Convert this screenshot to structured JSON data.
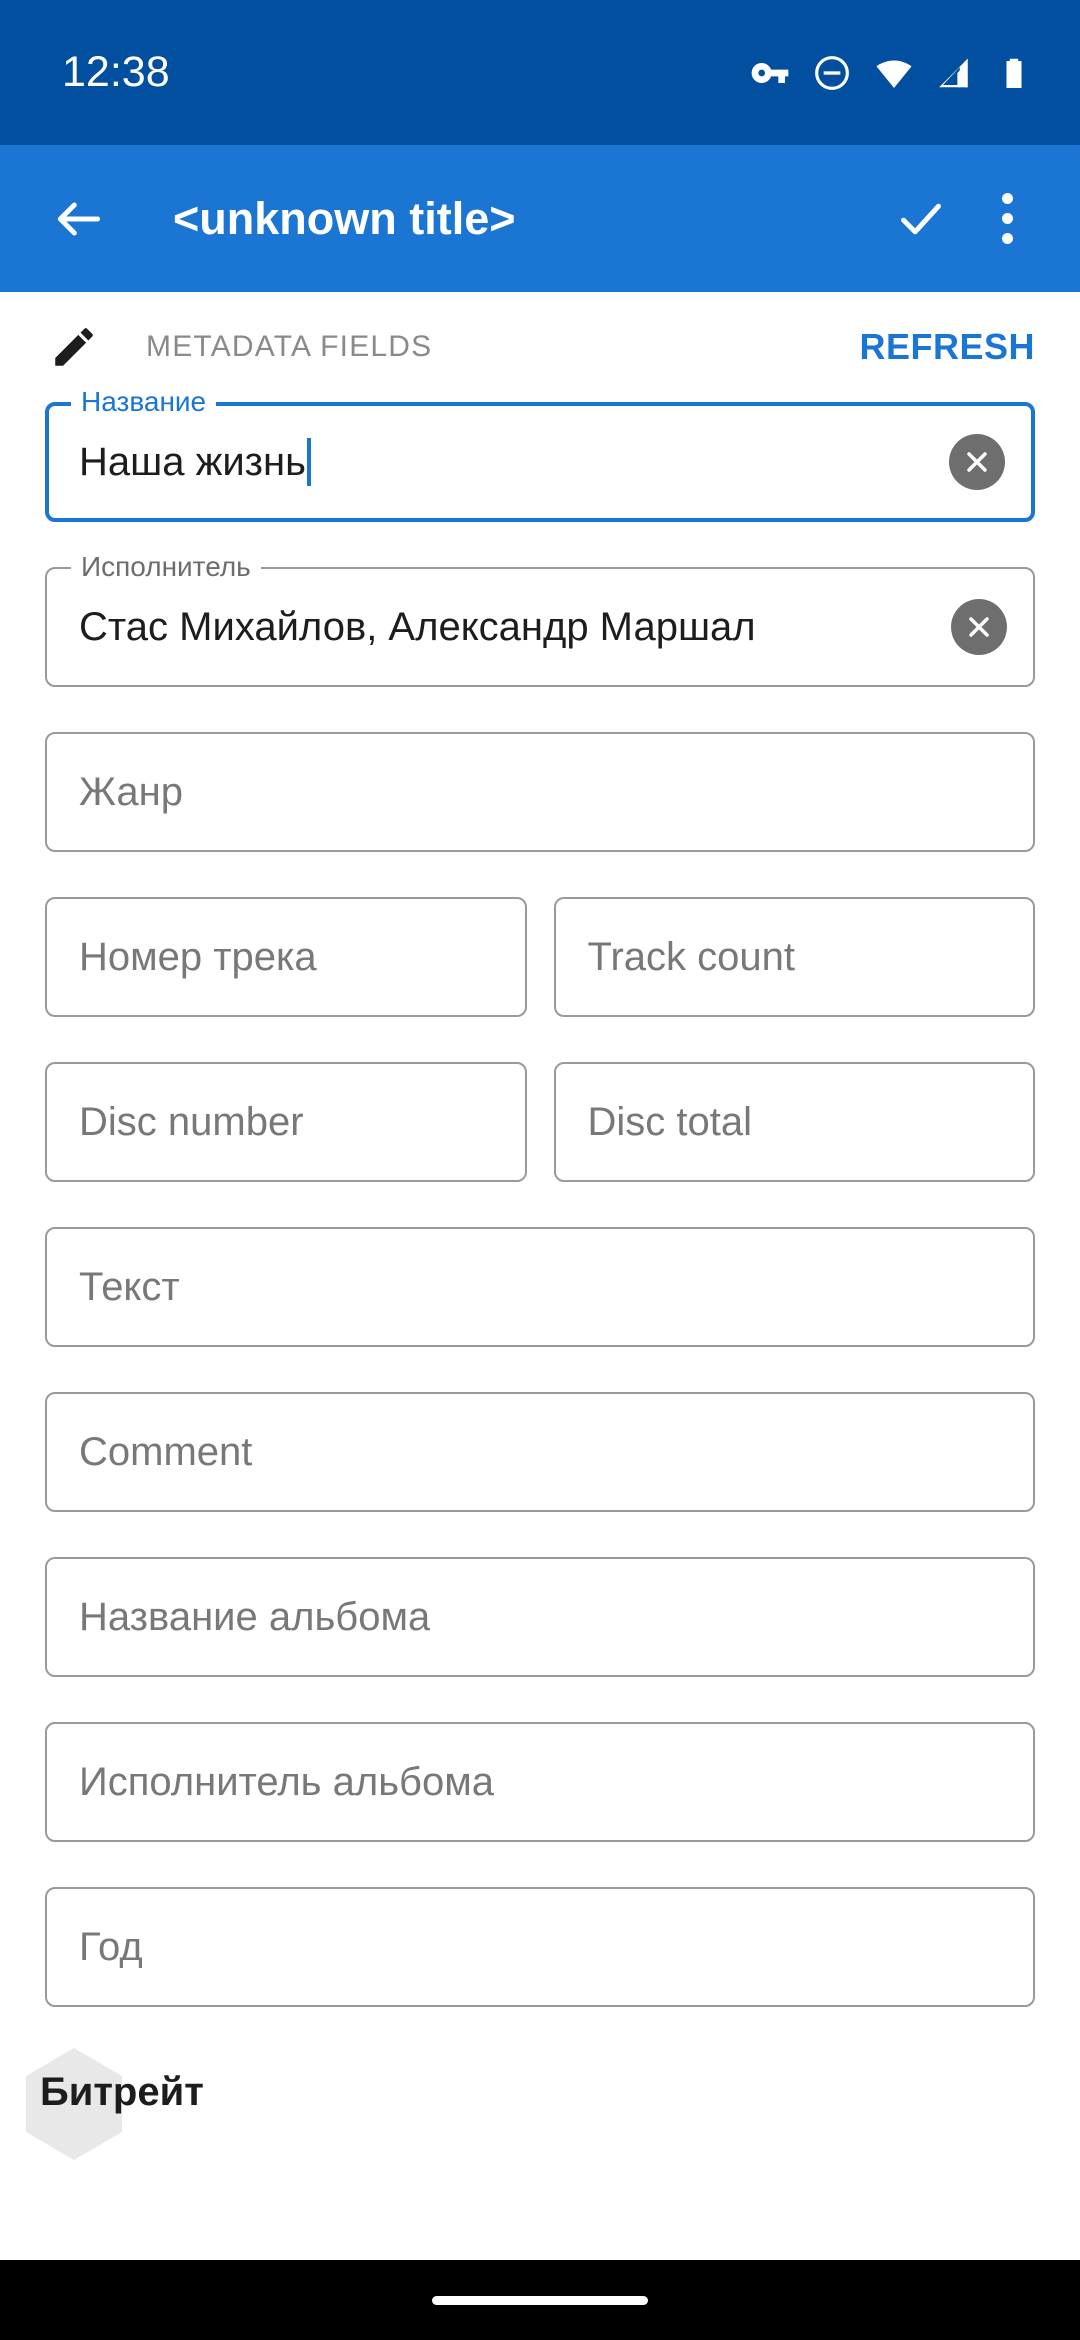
{
  "status_bar": {
    "time": "12:38",
    "background_color": "#014F9E",
    "icons": [
      "vpn-key-icon",
      "do-not-disturb-icon",
      "wifi-icon",
      "cellular-signal-icon",
      "battery-icon"
    ]
  },
  "app_bar": {
    "background_color": "#1A76D2",
    "back_label": "back-arrow",
    "title": "<unknown title>",
    "confirm_label": "check",
    "overflow_label": "more-options"
  },
  "section": {
    "icon": "pencil-icon",
    "title": "METADATA FIELDS",
    "refresh_label": "REFRESH",
    "accent_color": "#1B76D3"
  },
  "fields": [
    {
      "name": "title",
      "label": "Название",
      "value": "Наша жизнь",
      "placeholder": "Название",
      "focused": true,
      "has_clear": true,
      "full_width": true
    },
    {
      "name": "artist",
      "label": "Исполнитель",
      "value": "Стас Михайлов, Александр Маршал",
      "placeholder": "Исполнитель",
      "focused": false,
      "has_clear": true,
      "full_width": true
    },
    {
      "name": "genre",
      "label": "Жанр",
      "value": "",
      "placeholder": "Жанр",
      "focused": false,
      "has_clear": false,
      "full_width": true
    },
    {
      "name": "track-number",
      "label": "Номер трека",
      "value": "",
      "placeholder": "Номер трека",
      "focused": false,
      "has_clear": false,
      "full_width": false
    },
    {
      "name": "track-count",
      "label": "Track count",
      "value": "",
      "placeholder": "Track count",
      "focused": false,
      "has_clear": false,
      "full_width": false
    },
    {
      "name": "disc-number",
      "label": "Disc number",
      "value": "",
      "placeholder": "Disc number",
      "focused": false,
      "has_clear": false,
      "full_width": false
    },
    {
      "name": "disc-total",
      "label": "Disc total",
      "value": "",
      "placeholder": "Disc total",
      "focused": false,
      "has_clear": false,
      "full_width": false
    },
    {
      "name": "lyrics",
      "label": "Текст",
      "value": "",
      "placeholder": "Текст",
      "focused": false,
      "has_clear": false,
      "full_width": true
    },
    {
      "name": "comment",
      "label": "Comment",
      "value": "",
      "placeholder": "Comment",
      "focused": false,
      "has_clear": false,
      "full_width": true
    },
    {
      "name": "album-title",
      "label": "Название альбома",
      "value": "",
      "placeholder": "Название альбома",
      "focused": false,
      "has_clear": false,
      "full_width": true
    },
    {
      "name": "album-artist",
      "label": "Исполнитель альбома",
      "value": "",
      "placeholder": "Исполнитель альбома",
      "focused": false,
      "has_clear": false,
      "full_width": true
    },
    {
      "name": "year",
      "label": "Год",
      "value": "",
      "placeholder": "Год",
      "focused": false,
      "has_clear": false,
      "full_width": true
    }
  ],
  "partial_field": {
    "name": "bitrate",
    "placeholder": "Битрейт"
  }
}
